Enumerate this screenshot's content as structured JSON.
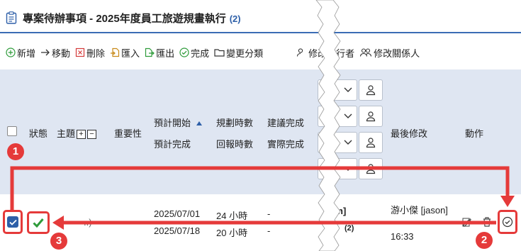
{
  "header": {
    "title": "專案待辦事項 - 2025年度員工旅遊規畫執行",
    "count": "(2)"
  },
  "toolbar": {
    "add": "新增",
    "move": "移動",
    "delete": "刪除",
    "import": "匯入",
    "export": "匯出",
    "complete": "完成",
    "change_category": "變更分類",
    "change_executor": "修改執行者",
    "change_related": "修改關係人"
  },
  "table": {
    "headers": {
      "status": "狀態",
      "subject": "主題",
      "importance": "重要性",
      "planned_start": "預計開始",
      "planned_end": "預計完成",
      "planned_hours": "規劃時數",
      "reported_hours": "回報時數",
      "suggested_done": "建議完成",
      "actual_done": "實際完成",
      "last_modified": "最後修改",
      "action": "動作"
    },
    "expand_symbol": "+",
    "collapse_symbol": "−",
    "row": {
      "subject_fragment": "..)",
      "planned_start": "2025/07/01",
      "planned_end": "2025/07/18",
      "planned_hours": "24 小時",
      "reported_hours": "20 小時",
      "suggested_done": "-",
      "actual_done": "-",
      "mid_fragment_1": "n]",
      "mid_fragment_2": "(2)",
      "modified_by": "游小傑 [jason]",
      "modified_time": "16:33"
    }
  },
  "annotations": {
    "step1": "1",
    "step2": "2",
    "step3": "3"
  },
  "colors": {
    "accent": "#2d5fa8",
    "header_bg": "#dfe6f2",
    "annotation": "#e53a3a",
    "success": "#2e9b3a"
  }
}
